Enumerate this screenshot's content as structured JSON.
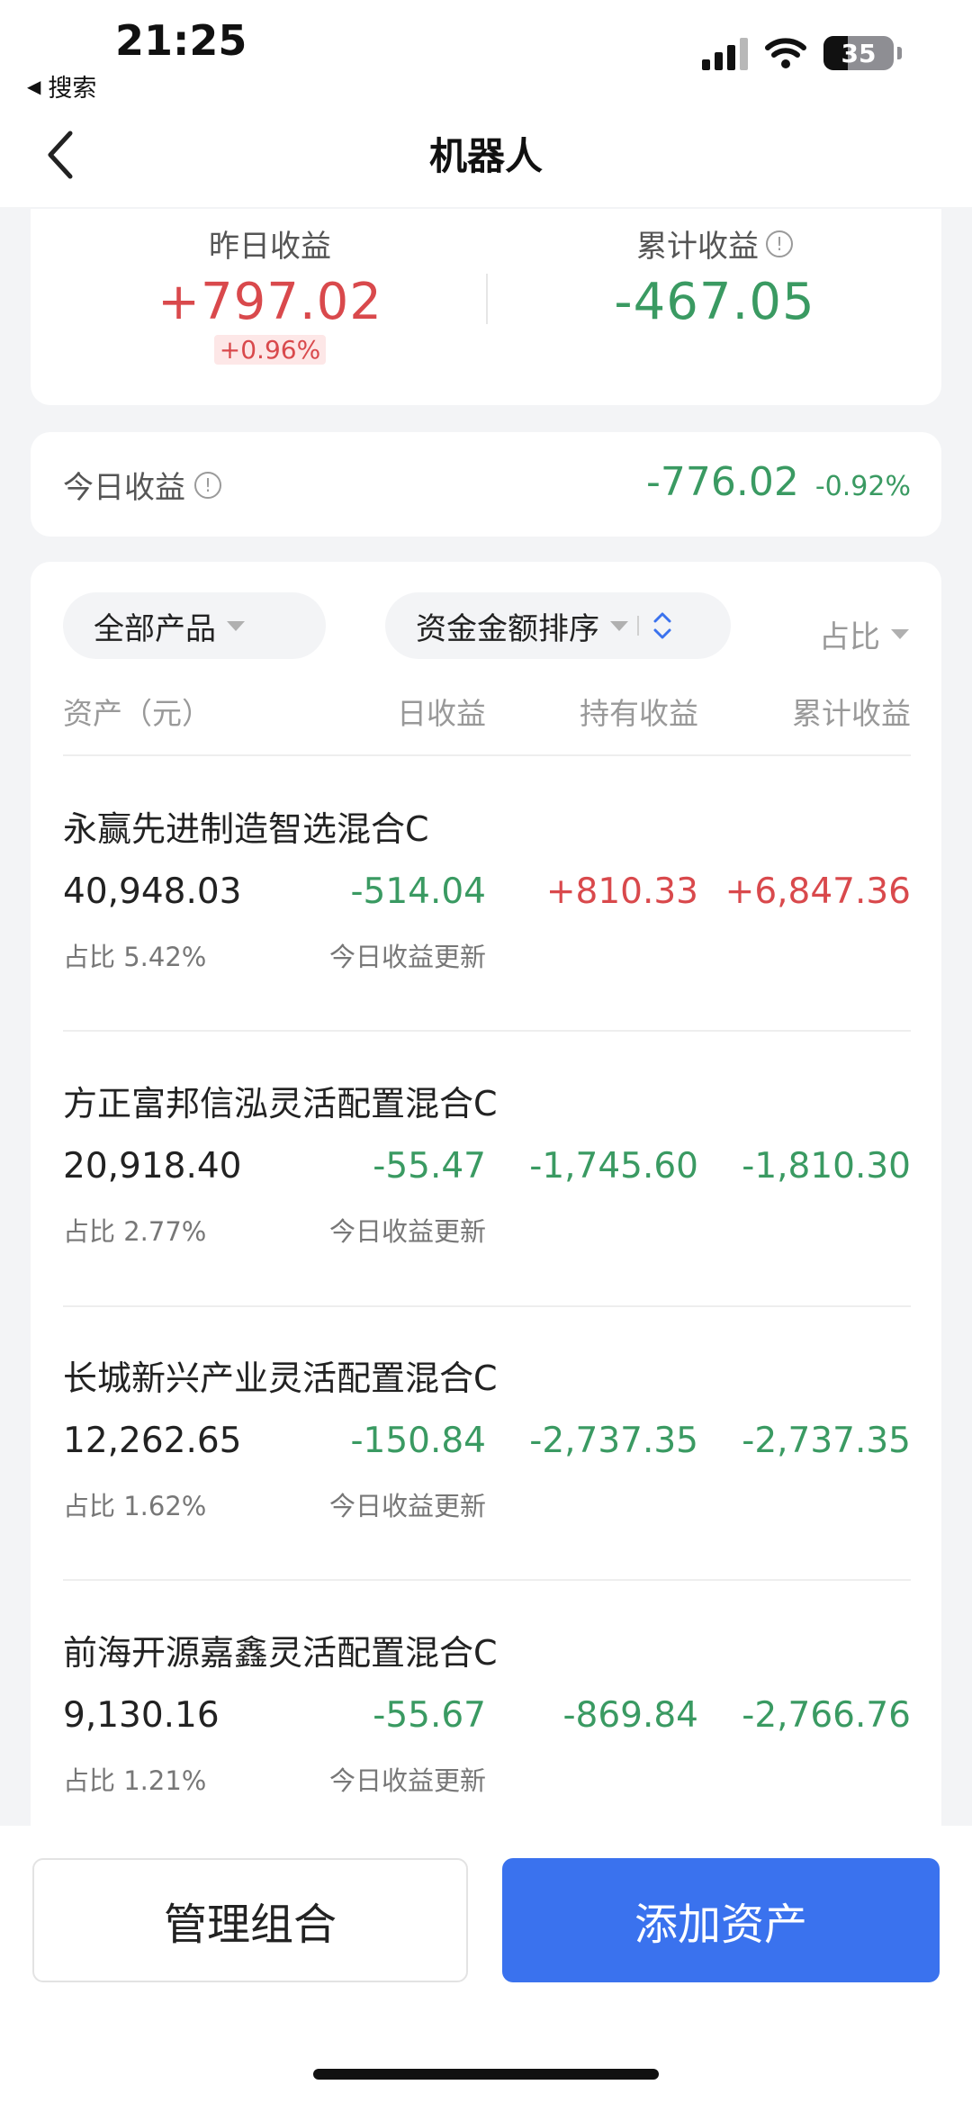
{
  "status_bar": {
    "time": "21:25",
    "back_app": "搜索",
    "battery_level": "35",
    "battery_fraction": 0.35
  },
  "nav": {
    "title": "机器人"
  },
  "summary": {
    "yesterday_label": "昨日收益",
    "yesterday_value": "+797.02",
    "yesterday_pct": "+0.96%",
    "total_label": "累计收益",
    "total_value": "-467.05"
  },
  "today": {
    "label": "今日收益",
    "value": "-776.02",
    "pct": "-0.92%"
  },
  "filters": {
    "product": "全部产品",
    "sort": "资金金额排序",
    "share": "占比"
  },
  "columns": {
    "asset": "资产（元）",
    "daily": "日收益",
    "holding": "持有收益",
    "cumulative": "累计收益"
  },
  "funds": [
    {
      "name": "永赢先进制造智选混合C",
      "asset": "40,948.03",
      "daily": "-514.04",
      "holding": "+810.33",
      "cumulative": "+6,847.36",
      "share": "占比 5.42%",
      "note": "今日收益更新"
    },
    {
      "name": "方正富邦信泓灵活配置混合C",
      "asset": "20,918.40",
      "daily": "-55.47",
      "holding": "-1,745.60",
      "cumulative": "-1,810.30",
      "share": "占比 2.77%",
      "note": "今日收益更新"
    },
    {
      "name": "长城新兴产业灵活配置混合C",
      "asset": "12,262.65",
      "daily": "-150.84",
      "holding": "-2,737.35",
      "cumulative": "-2,737.35",
      "share": "占比 1.62%",
      "note": "今日收益更新"
    },
    {
      "name": "前海开源嘉鑫灵活配置混合C",
      "asset": "9,130.16",
      "daily": "-55.67",
      "holding": "-869.84",
      "cumulative": "-2,766.76",
      "share": "占比 1.21%",
      "note": "今日收益更新"
    }
  ],
  "actions": {
    "manage": "管理组合",
    "add": "添加资产"
  },
  "colors": {
    "positive": "#d9494c",
    "negative": "#3a9a62",
    "primary": "#3a72ee"
  }
}
